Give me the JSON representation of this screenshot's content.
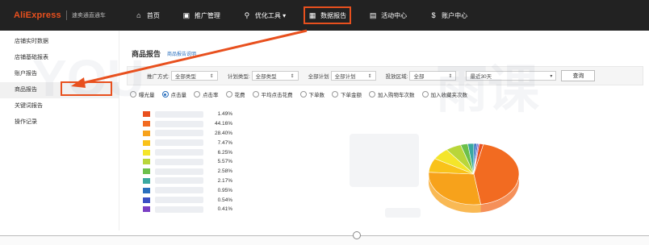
{
  "app": {
    "brand": "AliExpress",
    "sub": "速卖通直通车"
  },
  "nav": [
    {
      "label": "首页",
      "icon": "home-icon",
      "glyph": "⌂"
    },
    {
      "label": "推广管理",
      "icon": "briefcase-icon",
      "glyph": "▣"
    },
    {
      "label": "优化工具 ▾",
      "icon": "search-icon",
      "glyph": "⚲"
    },
    {
      "label": "数据报告",
      "icon": "chart-icon",
      "glyph": "▦",
      "active": true
    },
    {
      "label": "活动中心",
      "icon": "calendar-icon",
      "glyph": "▤"
    },
    {
      "label": "账户中心",
      "icon": "account-icon",
      "glyph": "$"
    }
  ],
  "sidebar": {
    "items": [
      {
        "label": "店铺实时数据"
      },
      {
        "label": "店铺基础报表"
      },
      {
        "label": "账户报告"
      },
      {
        "label": "商品报告",
        "active": true
      },
      {
        "label": "关键词报告"
      },
      {
        "label": "操作记录"
      }
    ]
  },
  "main": {
    "title": "商品报告",
    "title_note": "商品报告说明"
  },
  "filters": {
    "promo_type_label": "推广方式:",
    "promo_type_value": "全部类型",
    "plan_type_label": "计划类型:",
    "plan_type_value": "全部类型",
    "plan_label": "全部计划",
    "plan_value": "全部计划",
    "region_label": "投放区域:",
    "region_value": "全部",
    "date_value": "最近30天",
    "query_label": "查询"
  },
  "metrics": [
    {
      "label": "曝光量",
      "checked": false
    },
    {
      "label": "点击量",
      "checked": true
    },
    {
      "label": "点击率",
      "checked": false
    },
    {
      "label": "花费",
      "checked": false
    },
    {
      "label": "平均点击花费",
      "checked": false
    },
    {
      "label": "下单数",
      "checked": false
    },
    {
      "label": "下单金额",
      "checked": false
    },
    {
      "label": "加入购物车次数",
      "checked": false
    },
    {
      "label": "加入收藏夹次数",
      "checked": false
    }
  ],
  "chart_data": {
    "type": "pie",
    "title": "",
    "slices": [
      {
        "name": "",
        "value": 1.49,
        "label": "1.49%",
        "color": "#e8501e"
      },
      {
        "name": "",
        "value": 44.16,
        "label": "44.16%",
        "color": "#f26b21"
      },
      {
        "name": "",
        "value": 28.4,
        "label": "28.40%",
        "color": "#f7a21b"
      },
      {
        "name": "",
        "value": 7.47,
        "label": "7.47%",
        "color": "#f9c21a"
      },
      {
        "name": "",
        "value": 6.25,
        "label": "6.25%",
        "color": "#f4e52a"
      },
      {
        "name": "",
        "value": 5.57,
        "label": "5.57%",
        "color": "#b9d63a"
      },
      {
        "name": "",
        "value": 2.58,
        "label": "2.58%",
        "color": "#6cc04a"
      },
      {
        "name": "",
        "value": 2.17,
        "label": "2.17%",
        "color": "#3aa8a0"
      },
      {
        "name": "",
        "value": 0.95,
        "label": "0.95%",
        "color": "#2a6fbd"
      },
      {
        "name": "",
        "value": 0.54,
        "label": "0.54%",
        "color": "#3b4fc4"
      },
      {
        "name": "",
        "value": 0.41,
        "label": "0.41%",
        "color": "#7a3fc4"
      }
    ]
  },
  "watermark": {
    "text": "YOUKE 雨课"
  },
  "colors": {
    "accent": "#e8501e",
    "link": "#2a6fbd",
    "topbar": "#222222"
  }
}
